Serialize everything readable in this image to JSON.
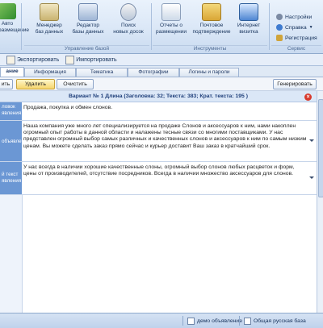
{
  "ribbon": {
    "buttons": [
      {
        "label": "Авто\nразмещение"
      },
      {
        "label": "Менеджер\nбаз данных"
      },
      {
        "label": "Редактор\nбазы данных"
      },
      {
        "label": "Поиск\nновых досок"
      },
      {
        "label": "Отчеты о\nразмещении"
      },
      {
        "label": "Почтовое\nподтверждение"
      },
      {
        "label": "Интернет\nвизитка"
      }
    ],
    "groups": {
      "base": "Управление базой",
      "tools": "Инструменты",
      "service": "Сервис"
    },
    "service_items": [
      "Настройки",
      "Справка",
      "Регистрация"
    ]
  },
  "toolbar": {
    "export_label": "Экспортировать",
    "import_label": "Импортировать"
  },
  "tabs": [
    "ание",
    "Информация",
    "Тематика",
    "Фотографии",
    "Логины и пароли"
  ],
  "actions": {
    "add": "ить",
    "delete": "Удалить",
    "clear": "Очистить",
    "generate": "Генерировать"
  },
  "variant_header": "Вариант № 1 Длина (Заголовка: 32; Текста: 383; Крат. текста: 195 )",
  "fields": [
    {
      "label": "ловок\nявления",
      "text": "Продажа, покупка и обмен слонов."
    },
    {
      "label": "объявления",
      "text": "Наша компания уже много лет специализируется на продаже Слонов и аксессуаров к ним, нами накоплен огромный опыт работы в данной области и налажены тесные связи со многими поставщиками. У нас представлен огромный выбор самых различных и качественных слонов и аксессуаров к ним по самым низким ценам. Вы можете сделать заказ прямо сейчас и курьер доставит Ваш заказ в кратчайший срок."
    },
    {
      "label": "й текст\nявления",
      "text": "У нас всегда в наличии хорошие качественные слоны, огромный выбор слонов любых расцветок и форм, цены от производителей, отсутствие посредников. Всегда в наличии множество аксессуаров для слонов."
    }
  ],
  "status": {
    "item1": "демо объявление",
    "item2": "Общая русская база"
  },
  "colors": {
    "ribbon_bg": "#d9e6f6",
    "label_blue": "#6b97d4",
    "header_text": "#1f3f7a",
    "close_red": "#d83a2d",
    "delete_yellow": "#f6d66d"
  }
}
